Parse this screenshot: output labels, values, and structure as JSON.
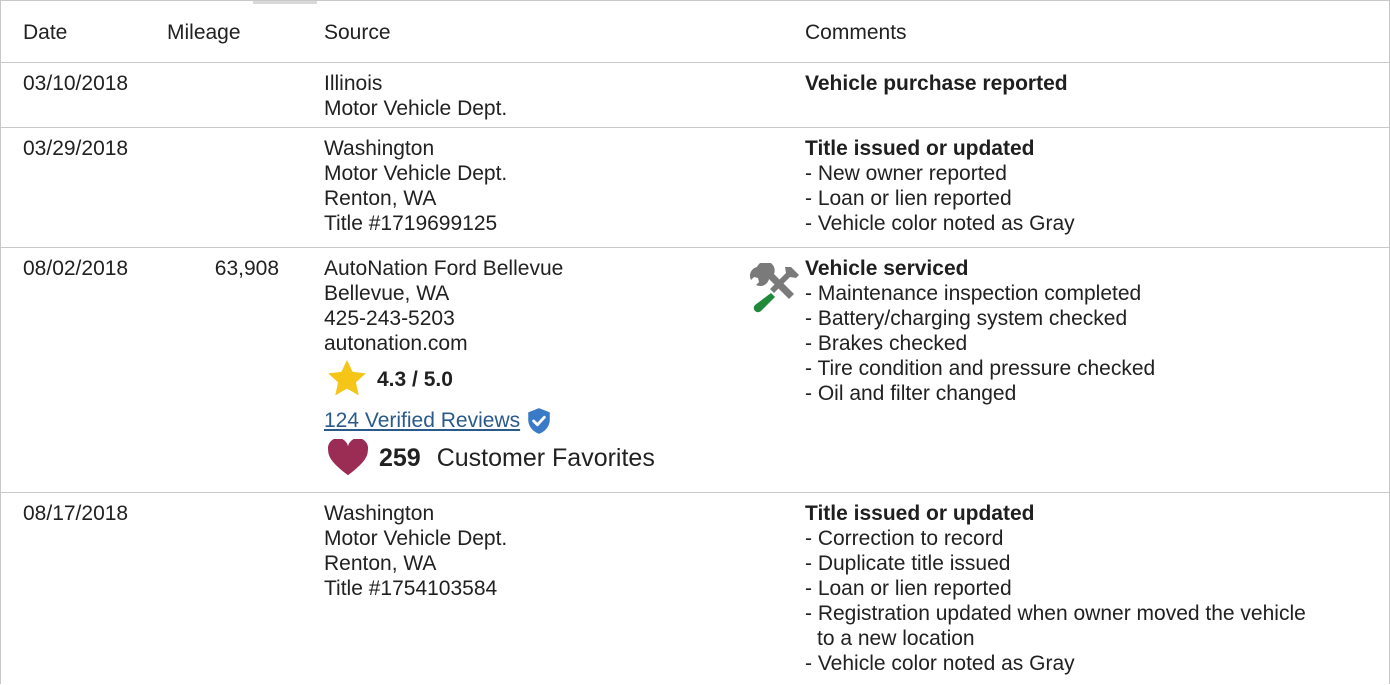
{
  "columns": {
    "date": "Date",
    "mileage": "Mileage",
    "source": "Source",
    "comments": "Comments"
  },
  "rows": [
    {
      "date": "03/10/2018",
      "mileage": "",
      "source": [
        "Illinois",
        "Motor Vehicle Dept."
      ],
      "comment_title": "Vehicle purchase reported",
      "comment_items": []
    },
    {
      "date": "03/29/2018",
      "mileage": "",
      "source": [
        "Washington",
        "Motor Vehicle Dept.",
        "Renton, WA",
        "Title #1719699125"
      ],
      "comment_title": "Title issued or updated",
      "comment_items": [
        "- New owner reported",
        "- Loan or lien reported",
        "- Vehicle color noted as Gray"
      ]
    },
    {
      "date": "08/02/2018",
      "mileage": "63,908",
      "source": [
        "AutoNation Ford Bellevue",
        "Bellevue, WA",
        "425-243-5203",
        "autonation.com"
      ],
      "comment_title": "Vehicle serviced",
      "comment_items": [
        "- Maintenance inspection completed",
        "- Battery/charging system checked",
        "- Brakes checked",
        "- Tire condition and pressure checked",
        "- Oil and filter changed"
      ],
      "rating": "4.3 / 5.0",
      "reviews_link": "124 Verified Reviews",
      "favorites_count": "259",
      "favorites_label": "Customer Favorites"
    },
    {
      "date": "08/17/2018",
      "mileage": "",
      "source": [
        "Washington",
        "Motor Vehicle Dept.",
        "Renton, WA",
        "Title #1754103584"
      ],
      "comment_title": "Title issued or updated",
      "comment_items": [
        "- Correction to record",
        "- Duplicate title issued",
        "- Loan or lien reported",
        "- Registration updated when owner moved the vehicle",
        "to a new location",
        "- Vehicle color noted as Gray"
      ]
    }
  ],
  "icons": {
    "star": "star-icon",
    "verified": "verified-shield-icon",
    "heart": "heart-icon",
    "service": "wrench-screwdriver-icon"
  },
  "colors": {
    "star": "#f5c518",
    "verified": "#3a7bc8",
    "heart": "#9b2d55",
    "link": "#2a5a8c",
    "tool_gray": "#7a7a7a",
    "tool_green": "#1f8a3a",
    "border": "#c9c9c9"
  }
}
